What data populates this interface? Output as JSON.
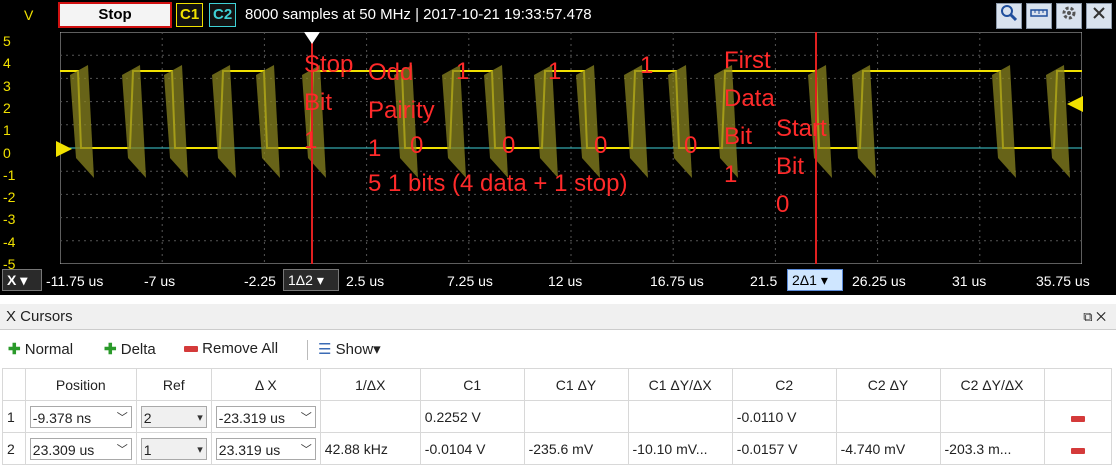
{
  "toolbar": {
    "y_unit": "V",
    "stop_label": "Stop",
    "ch1_label": "C1",
    "ch2_label": "C2",
    "title": "8000 samples at 50 MHz | 2017-10-21 19:33:57.478",
    "tools": [
      "zoom-icon",
      "ruler-icon",
      "settings-icon",
      "close-icon"
    ]
  },
  "colors": {
    "ch1": "#f1e100",
    "ch2": "#3fd1d6",
    "cursor": "#e02020",
    "annotation": "#ff2a2a"
  },
  "y_ticks": [
    "5",
    "4",
    "3",
    "2",
    "1",
    "0",
    "-1",
    "-2",
    "-3",
    "-4",
    "-5"
  ],
  "x_axis": {
    "label": "X",
    "ticks": [
      "-11.75 us",
      "-7 us",
      "-2.25",
      "2.5 us",
      "7.25 us",
      "12 us",
      "16.75 us",
      "21.5",
      "26.25 us",
      "31 us",
      "35.75 us"
    ],
    "cursor1_tag": "1Δ2",
    "cursor2_tag": "2Δ1"
  },
  "annotations": {
    "stop_bit": "Stop\nBit\n1",
    "odd_parity": "Odd\nPairity\n1",
    "bits": [
      "0",
      "1",
      "0",
      "1",
      "0",
      "1",
      "0"
    ],
    "summary": "5 1 bits (4 data + 1 stop)",
    "first_data_bit": "First\nData\nBit\n1",
    "start_bit": "Start\nBit\n0"
  },
  "panel": {
    "title": "X Cursors",
    "normal_label": "Normal",
    "delta_label": "Delta",
    "remove_all_label": "Remove All",
    "show_label": "Show"
  },
  "table": {
    "headers": [
      "",
      "Position",
      "Ref",
      "Δ X",
      "1/ΔX",
      "C1",
      "C1 ΔY",
      "C1 ΔY/ΔX",
      "C2",
      "C2 ΔY",
      "C2 ΔY/ΔX",
      ""
    ],
    "rows": [
      {
        "idx": "1",
        "position": "-9.378 ns",
        "ref": "2",
        "dx": "-23.319 us",
        "inv_dx": "",
        "c1": "0.2252 V",
        "c1_dy": "",
        "c1_dydx": "",
        "c2": "-0.0110 V",
        "c2_dy": "",
        "c2_dydx": ""
      },
      {
        "idx": "2",
        "position": "23.309 us",
        "ref": "1",
        "dx": "23.319 us",
        "inv_dx": "42.88 kHz",
        "c1": "-0.0104 V",
        "c1_dy": "-235.6 mV",
        "c1_dydx": "-10.10 mV...",
        "c2": "-0.0157 V",
        "c2_dy": "-4.740 mV",
        "c2_dydx": "-203.3 m..."
      }
    ]
  }
}
